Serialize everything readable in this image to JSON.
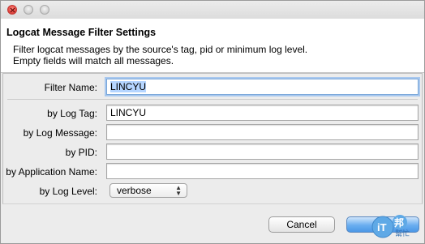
{
  "window": {
    "controls": [
      "close-button",
      "minimize-button",
      "zoom-button"
    ]
  },
  "header": {
    "title": "Logcat Message Filter Settings",
    "description_line1": "Filter logcat messages by the source's tag, pid or minimum log level.",
    "description_line2": "Empty fields will match all messages."
  },
  "form": {
    "filter_name": {
      "label": "Filter Name:",
      "value": "LINCYU"
    },
    "log_tag": {
      "label": "by Log Tag:",
      "value": "LINCYU"
    },
    "log_message": {
      "label": "by Log Message:",
      "value": ""
    },
    "pid": {
      "label": "by PID:",
      "value": ""
    },
    "app_name": {
      "label": "by Application Name:",
      "value": ""
    },
    "log_level": {
      "label": "by Log Level:",
      "value": "verbose"
    }
  },
  "buttons": {
    "cancel": "Cancel",
    "ok": ""
  },
  "watermark": {
    "text_it": "iT",
    "text_bang": "邦",
    "text_help": "幫忙"
  },
  "colors": {
    "accent": "#4b97e6",
    "focus_ring": "#a9c8ee",
    "selection": "#b5d5ff"
  }
}
